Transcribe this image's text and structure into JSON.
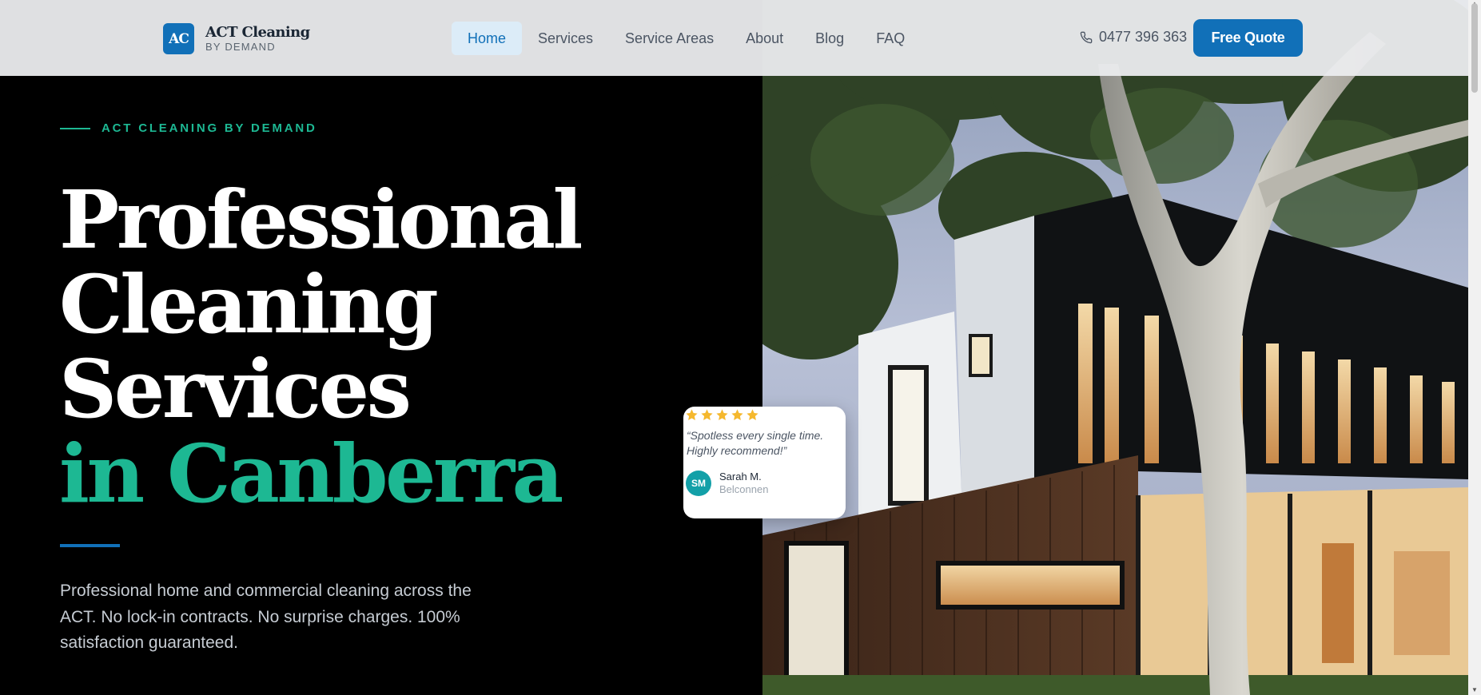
{
  "header": {
    "logo_mark": "AC",
    "logo_name": "ACT Cleaning",
    "logo_sub": "BY DEMAND",
    "nav": [
      {
        "label": "Home",
        "active": true
      },
      {
        "label": "Services",
        "active": false
      },
      {
        "label": "Service Areas",
        "active": false
      },
      {
        "label": "About",
        "active": false
      },
      {
        "label": "Blog",
        "active": false
      },
      {
        "label": "FAQ",
        "active": false
      }
    ],
    "phone": "0477 396 363",
    "phone_icon": "phone-icon",
    "cta_label": "Free Quote"
  },
  "hero": {
    "eyebrow": "ACT CLEANING BY DEMAND",
    "headline_line1": "Professional",
    "headline_line2": "Cleaning",
    "headline_line3": "Services",
    "headline_accent": "in Canberra",
    "lead": "Professional home and commercial cleaning across the ACT. No lock-in contracts. No surprise charges. 100% satisfaction guaranteed.",
    "image_icon": "modern-house-photo"
  },
  "review": {
    "rating": 5,
    "quote": "“Spotless every single time. Highly recommend!”",
    "avatar_initials": "SM",
    "name": "Sarah M.",
    "location": "Belconnen"
  },
  "colors": {
    "brand_blue": "#1170b8",
    "accent_green": "#1db893",
    "star": "#f5b82e"
  }
}
